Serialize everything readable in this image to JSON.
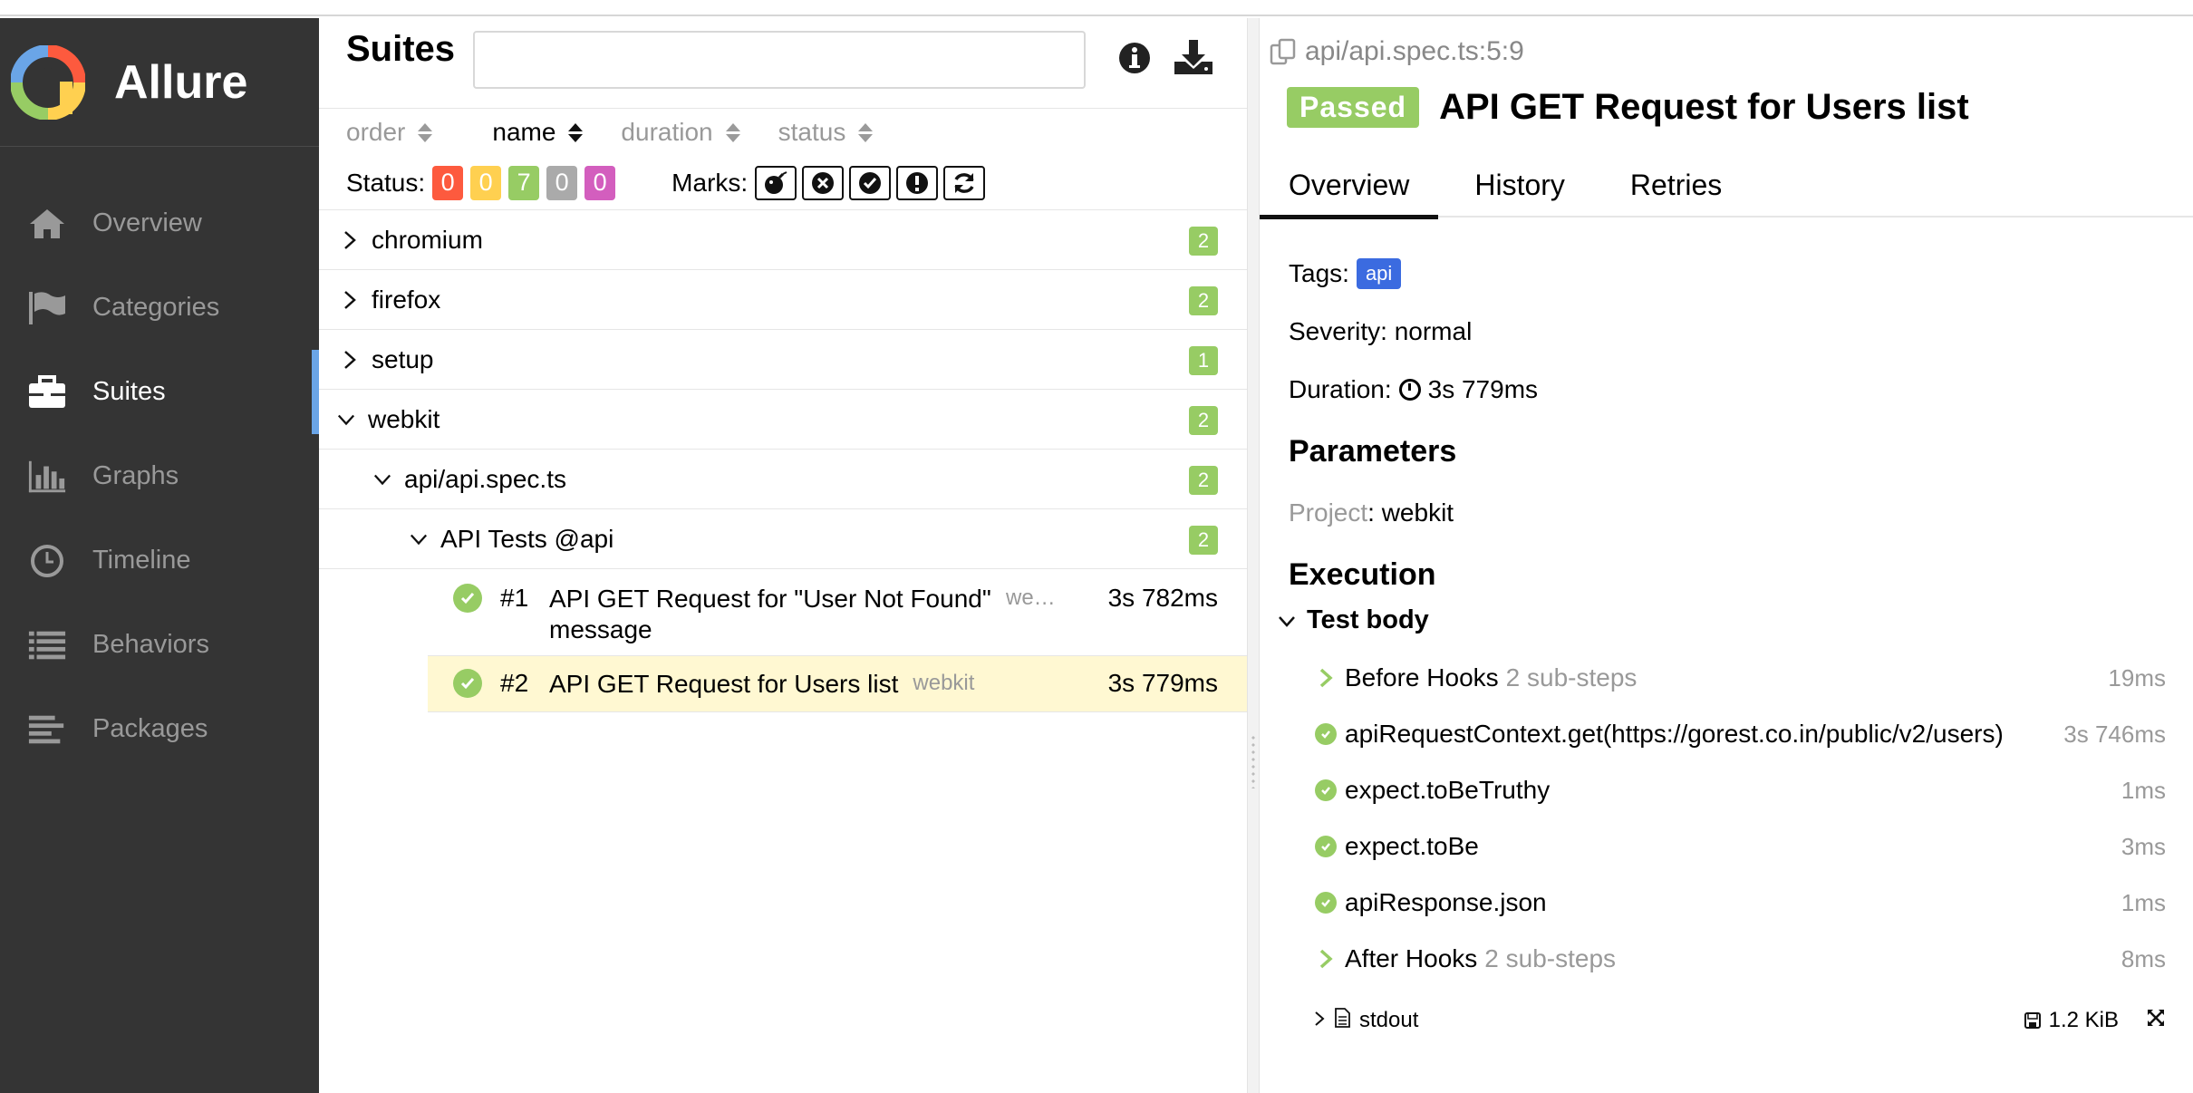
{
  "app": {
    "name": "Allure"
  },
  "sidebar": {
    "items": [
      {
        "label": "Overview",
        "icon": "home-icon"
      },
      {
        "label": "Categories",
        "icon": "flag-icon"
      },
      {
        "label": "Suites",
        "icon": "briefcase-icon",
        "active": true
      },
      {
        "label": "Graphs",
        "icon": "bar-chart-icon"
      },
      {
        "label": "Timeline",
        "icon": "clock-icon"
      },
      {
        "label": "Behaviors",
        "icon": "list-icon"
      },
      {
        "label": "Packages",
        "icon": "align-left-icon"
      }
    ]
  },
  "suites": {
    "title": "Suites",
    "search_value": "",
    "sort": [
      "order",
      "name",
      "duration",
      "status"
    ],
    "active_sort": "name",
    "status_label": "Status:",
    "status_counts": [
      {
        "value": "0",
        "color": "#fd5a3e"
      },
      {
        "value": "0",
        "color": "#ffd050"
      },
      {
        "value": "7",
        "color": "#97cc64"
      },
      {
        "value": "0",
        "color": "#aaaaaa"
      },
      {
        "value": "0",
        "color": "#d35ebe"
      }
    ],
    "marks_label": "Marks:",
    "tree": [
      {
        "label": "chromium",
        "count": "2",
        "expanded": false
      },
      {
        "label": "firefox",
        "count": "2",
        "expanded": false
      },
      {
        "label": "setup",
        "count": "1",
        "expanded": false
      },
      {
        "label": "webkit",
        "count": "2",
        "expanded": true
      },
      {
        "label": "api/api.spec.ts",
        "count": "2",
        "expanded": true
      },
      {
        "label": "API Tests @api",
        "count": "2",
        "expanded": true
      }
    ],
    "tests": [
      {
        "num": "#1",
        "name": "API GET Request for \"User Not Found\" message",
        "tag": "we…",
        "duration": "3s 782ms"
      },
      {
        "num": "#2",
        "name": "API GET Request for Users list",
        "tag": "webkit",
        "duration": "3s 779ms"
      }
    ]
  },
  "detail": {
    "path": "api/api.spec.ts:5:9",
    "status": "Passed",
    "title": "API GET Request for Users list",
    "tabs": [
      "Overview",
      "History",
      "Retries"
    ],
    "tags_label": "Tags:",
    "tag": "api",
    "severity": "Severity: normal",
    "duration_label": "Duration:",
    "duration": "3s 779ms",
    "parameters_heading": "Parameters",
    "param_key": "Project",
    "param_value": ": webkit",
    "execution_heading": "Execution",
    "test_body": "Test body",
    "steps": [
      {
        "name": "Before Hooks",
        "sub": "2 sub-steps",
        "duration": "19ms",
        "kind": "group"
      },
      {
        "name": "apiRequestContext.get(https://gorest.co.in/public/v2/users)",
        "sub": "",
        "duration": "3s 746ms",
        "kind": "pass"
      },
      {
        "name": "expect.toBeTruthy",
        "sub": "",
        "duration": "1ms",
        "kind": "pass"
      },
      {
        "name": "expect.toBe",
        "sub": "",
        "duration": "3ms",
        "kind": "pass"
      },
      {
        "name": "apiResponse.json",
        "sub": "",
        "duration": "1ms",
        "kind": "pass"
      },
      {
        "name": "After Hooks",
        "sub": "2 sub-steps",
        "duration": "8ms",
        "kind": "group"
      }
    ],
    "attachment": {
      "name": "stdout",
      "size": "1.2 KiB"
    }
  }
}
